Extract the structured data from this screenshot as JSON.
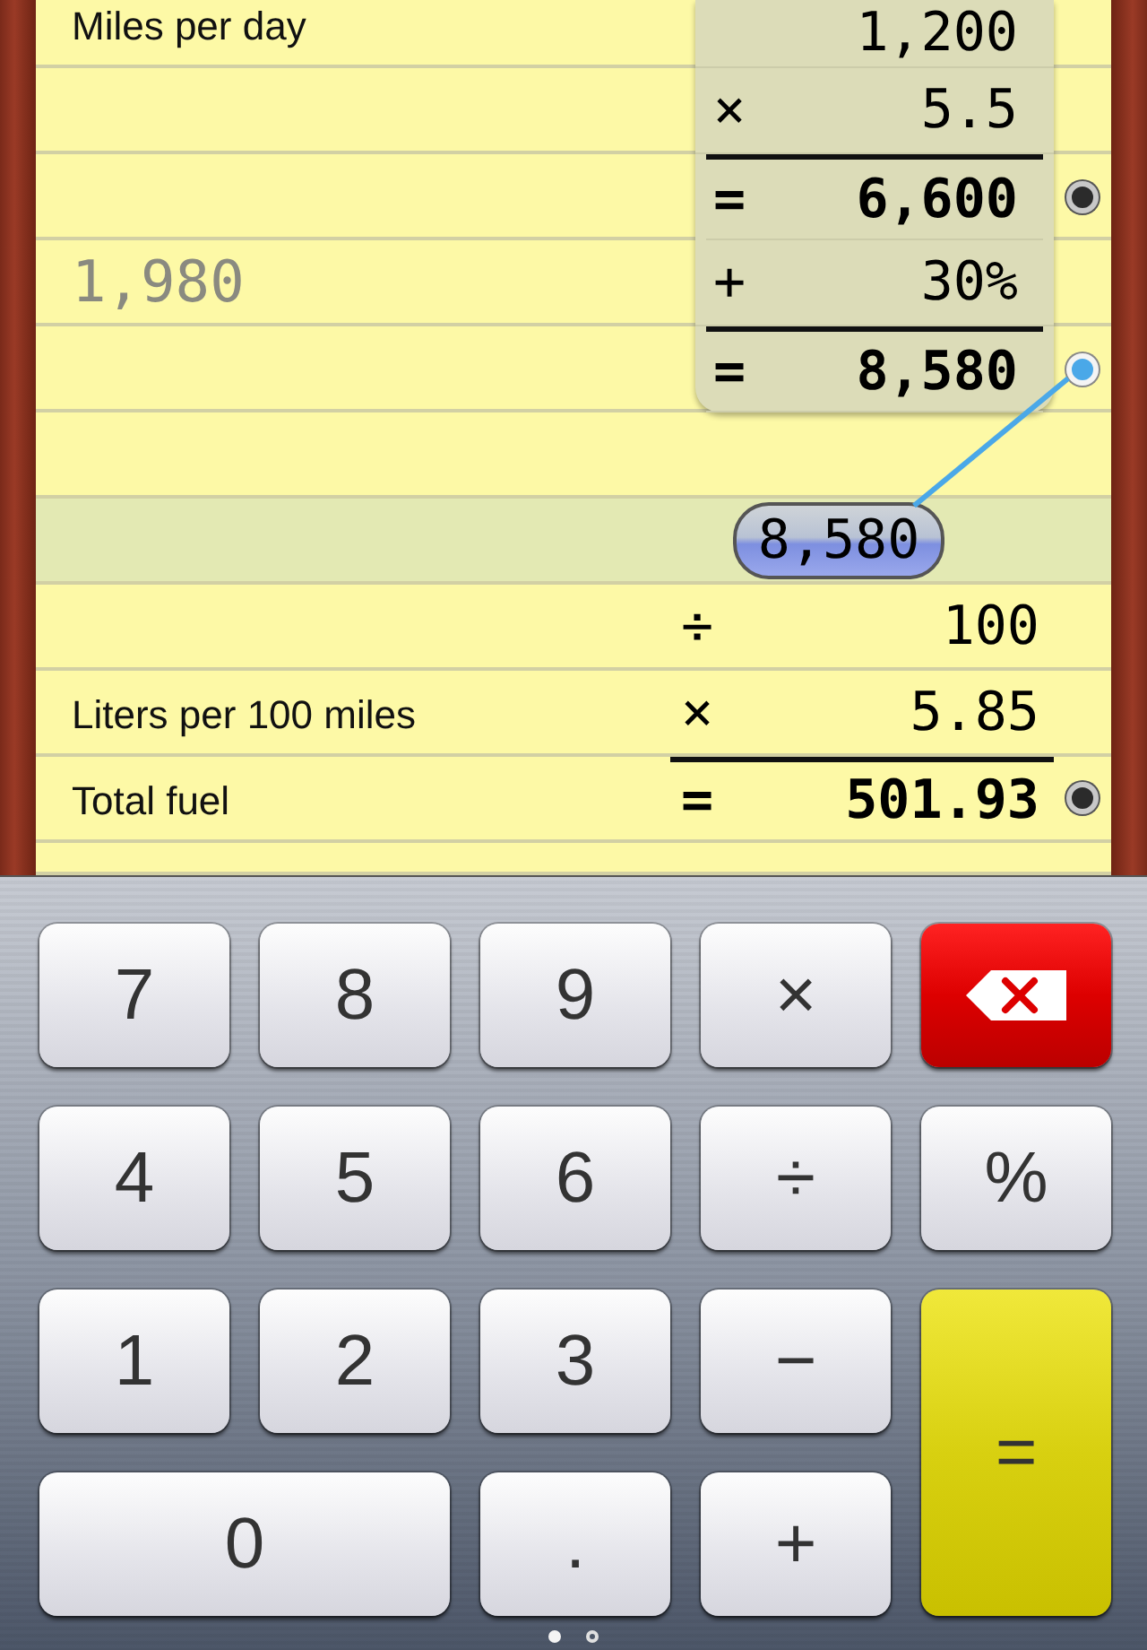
{
  "tape": {
    "entries": [
      {
        "kind": "operand",
        "value": "1,200"
      },
      {
        "kind": "operand",
        "op": "×",
        "value": "5.5"
      },
      {
        "kind": "result",
        "op": "=",
        "value": "6,600",
        "linked": false
      },
      {
        "kind": "operand",
        "op": "+",
        "value": "30%"
      },
      {
        "kind": "result",
        "op": "=",
        "value": "8,580",
        "linked": true
      }
    ]
  },
  "sheet": {
    "lines": [
      {
        "kind": "label",
        "label": "Miles per day"
      },
      {
        "kind": "blank"
      },
      {
        "kind": "blank"
      },
      {
        "kind": "note",
        "text": "1,980"
      },
      {
        "kind": "blank"
      },
      {
        "kind": "blank"
      },
      {
        "kind": "reference",
        "value": "8,580",
        "selected": true
      },
      {
        "kind": "calc",
        "op": "÷",
        "value": "100"
      },
      {
        "kind": "calc",
        "label": "Liters per 100 miles",
        "op": "×",
        "value": "5.85"
      },
      {
        "kind": "result",
        "label": "Total fuel",
        "op": "=",
        "value": "501.93",
        "linked": false
      },
      {
        "kind": "blank"
      }
    ]
  },
  "keypad": {
    "keys": [
      {
        "kind": "digit",
        "label": "7"
      },
      {
        "kind": "digit",
        "label": "8"
      },
      {
        "kind": "digit",
        "label": "9"
      },
      {
        "kind": "operator",
        "label": "×"
      },
      {
        "kind": "backspace"
      },
      {
        "kind": "digit",
        "label": "4"
      },
      {
        "kind": "digit",
        "label": "5"
      },
      {
        "kind": "digit",
        "label": "6"
      },
      {
        "kind": "operator",
        "label": "÷"
      },
      {
        "kind": "operator",
        "label": "%"
      },
      {
        "kind": "digit",
        "label": "1"
      },
      {
        "kind": "digit",
        "label": "2"
      },
      {
        "kind": "digit",
        "label": "3"
      },
      {
        "kind": "operator",
        "label": "−"
      },
      {
        "kind": "equals",
        "label": "="
      },
      {
        "kind": "wide-digit",
        "label": "0"
      },
      {
        "kind": "digit",
        "label": "."
      },
      {
        "kind": "operator",
        "label": "+"
      }
    ]
  },
  "pager": [
    {
      "selected": true
    },
    {
      "selected": false
    }
  ]
}
